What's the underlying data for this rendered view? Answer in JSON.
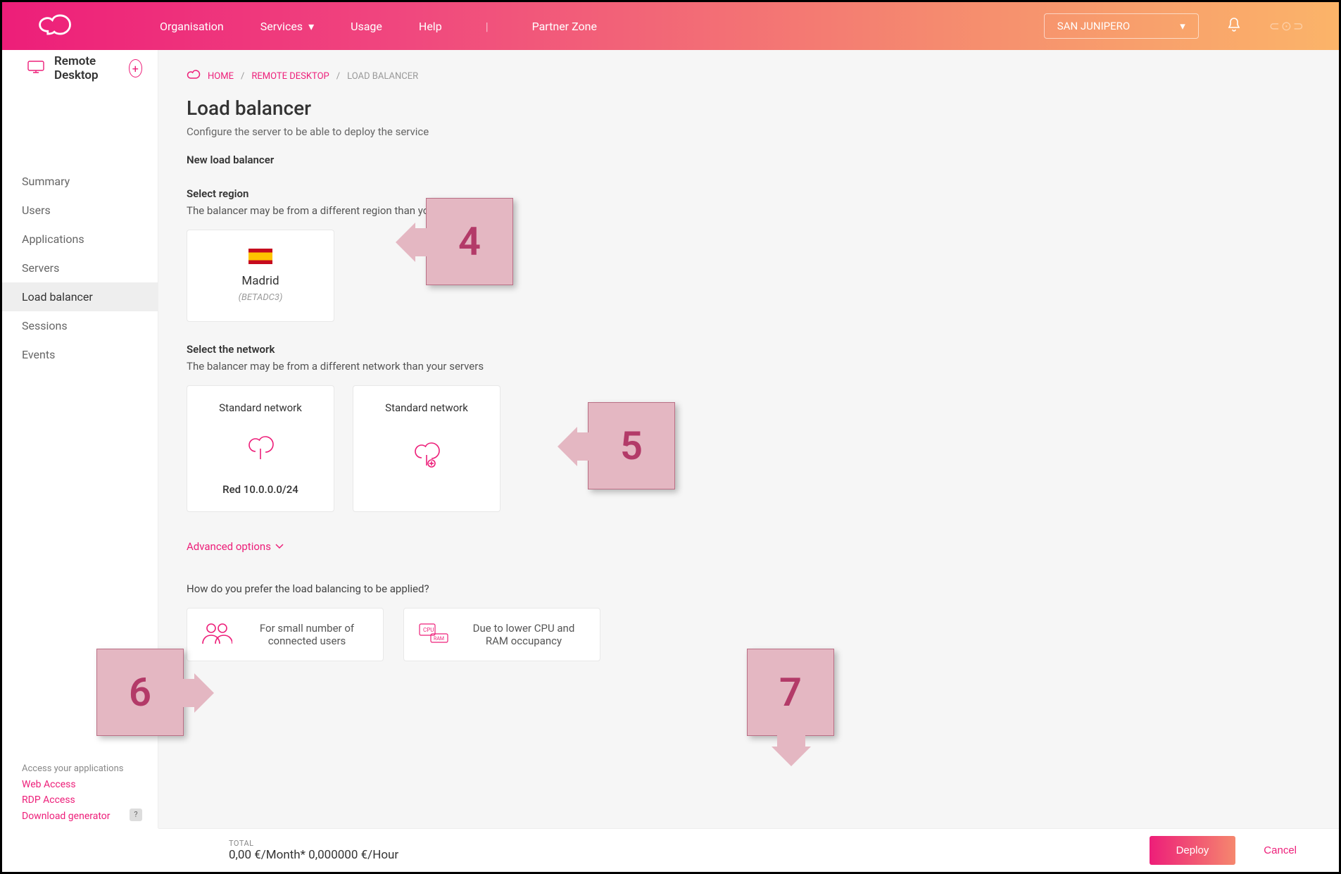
{
  "header": {
    "nav": {
      "organisation": "Organisation",
      "services": "Services",
      "usage": "Usage",
      "help": "Help",
      "partner": "Partner Zone"
    },
    "org_selected": "SAN JUNIPERO"
  },
  "sidebar": {
    "title": "Remote Desktop",
    "items": [
      "Summary",
      "Users",
      "Applications",
      "Servers",
      "Load balancer",
      "Sessions",
      "Events"
    ],
    "active_index": 4,
    "footer_hint": "Access your applications",
    "footer_links": [
      "Web Access",
      "RDP Access",
      "Download generator"
    ]
  },
  "breadcrumb": {
    "home": "HOME",
    "mid": "REMOTE DESKTOP",
    "current": "LOAD BALANCER"
  },
  "page": {
    "title": "Load balancer",
    "subtitle": "Configure the server to be able to deploy the service",
    "section_new": "New load balancer",
    "region_label": "Select region",
    "region_help": "The balancer may be from a different region than your servers",
    "region_card": {
      "name": "Madrid",
      "code": "(BETADC3)"
    },
    "network_label": "Select the network",
    "network_help": "The balancer may be from a different network than your servers",
    "network_cards": [
      {
        "title": "Standard network",
        "detail": "Red 10.0.0.0/24"
      },
      {
        "title": "Standard network",
        "detail": ""
      }
    ],
    "advanced": "Advanced options",
    "pref_question": "How do you prefer the load balancing to be applied?",
    "pref_cards": [
      "For small number of connected users",
      "Due to lower CPU and RAM occupancy"
    ]
  },
  "footer": {
    "total_label": "TOTAL",
    "total_value": "0,00 €/Month* 0,000000 €/Hour",
    "deploy": "Deploy",
    "cancel": "Cancel"
  },
  "callouts": {
    "c4": "4",
    "c5": "5",
    "c6": "6",
    "c7": "7"
  }
}
